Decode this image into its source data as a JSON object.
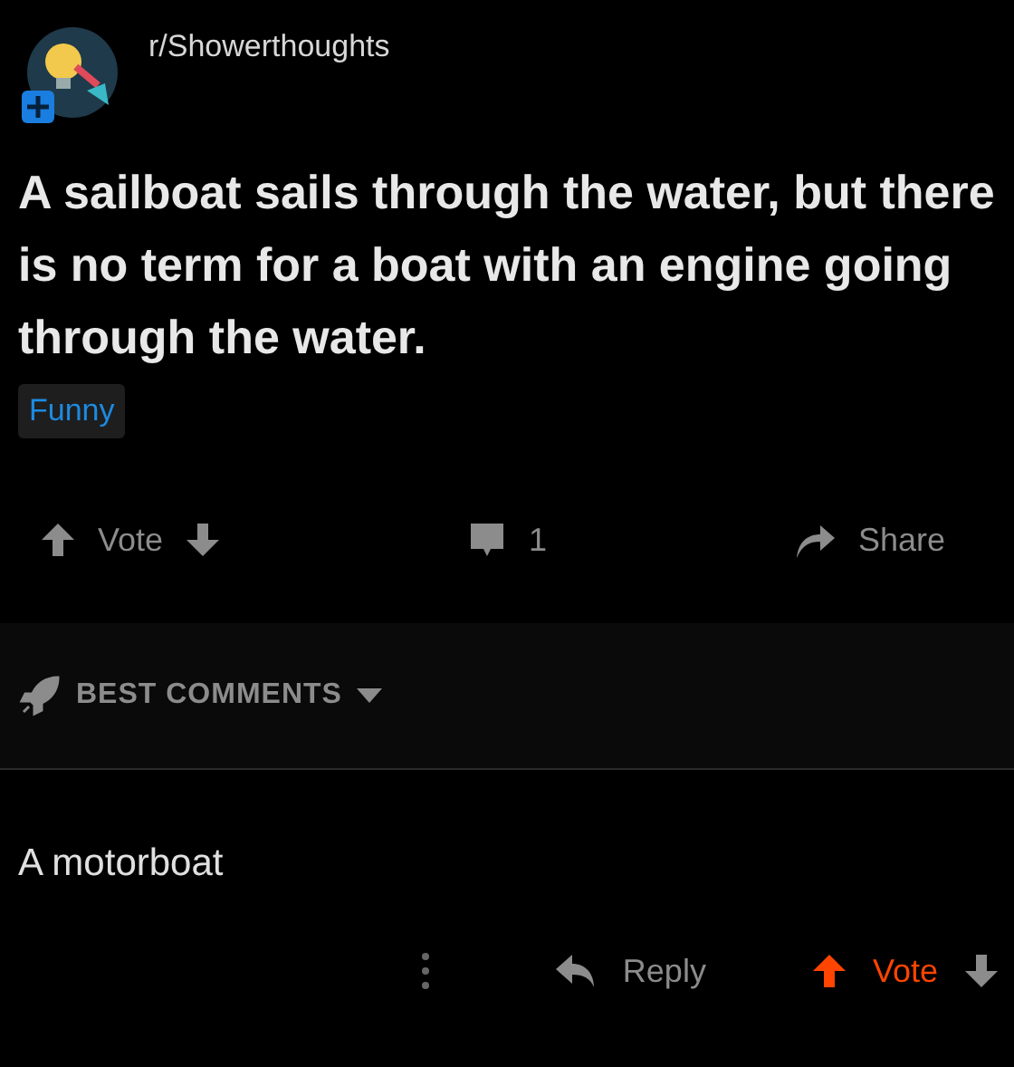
{
  "post": {
    "subreddit": "r/Showerthoughts",
    "title": "A sailboat sails through the water, but there is no term for a boat with an engine going through the water.",
    "flair": "Funny",
    "upvoted": false,
    "downvoted": false,
    "vote_label": "Vote",
    "comment_count": "1",
    "share_label": "Share"
  },
  "sort": {
    "label": "BEST COMMENTS"
  },
  "comments": [
    {
      "body": "A motorboat",
      "reply_label": "Reply",
      "vote_label": "Vote",
      "upvoted": true,
      "downvoted": false
    }
  ]
}
